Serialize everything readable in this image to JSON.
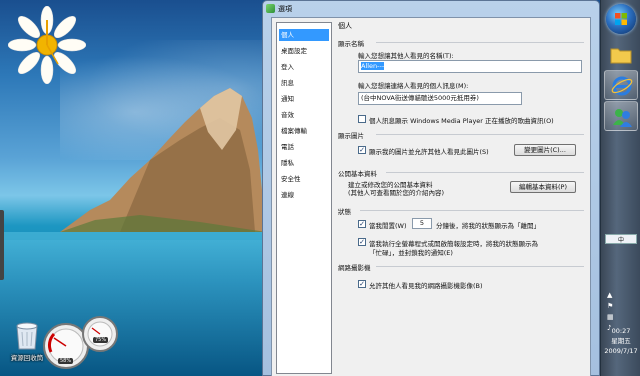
{
  "desktop": {
    "recycle_bin_label": "資源回收筒",
    "gauge_cpu": "58%",
    "gauge_mem": "75%"
  },
  "window": {
    "title": "選項",
    "nav_items": [
      "個人",
      "桌面設定",
      "登入",
      "訊息",
      "通知",
      "音效",
      "檔案傳輸",
      "電話",
      "隱私",
      "安全性",
      "連線"
    ],
    "pane_title": "個人",
    "display_name": {
      "section": "顯示名稱",
      "name_label": "輸入您想讓其他人看見的名稱(T):",
      "name_value": "Allen---",
      "message_label": "輸入您想讓連絡人看見的個人訊息(M):",
      "message_value": "(台中NOVA街送傳貓聽送5000元抵用券)",
      "media_checkbox": "個人訊息顯示 Windows Media Player 正在播放的歌曲資訊(O)",
      "media_checked": false
    },
    "display_picture": {
      "section": "顯示圖片",
      "show_checkbox": "顯示我的圖片並允許其他人看見此圖片(S)",
      "show_checked": true,
      "change_button": "變更圖片(C)..."
    },
    "public_profile": {
      "section": "公開基本資料",
      "desc_line1": "建立或修改您的公開基本資料",
      "desc_line2": "(其他人可查看關於您的介紹內容)",
      "edit_button": "編輯基本資料(P)"
    },
    "status": {
      "section": "狀態",
      "away_prefix": "當我閒置(W)",
      "away_minutes": "5",
      "away_suffix": "分鐘後，將我的狀態顯示為「離開」",
      "away_checked": true,
      "busy_line1": "當我執行全螢幕程式或開啟簡報設定時，將我的狀態顯示為",
      "busy_line2": "「忙碌」，並封鎖我的通知(E)",
      "busy_checked": true
    },
    "webcam": {
      "section": "網路攝影機",
      "allow_checkbox": "允許其他人看見我的網路攝影機影像(B)",
      "allow_checked": true
    }
  },
  "taskbar": {
    "ime_label": "中",
    "clock_time": "00:27",
    "clock_day": "星期五",
    "clock_date": "2009/7/17"
  },
  "colors": {
    "selection": "#3399ff",
    "window_frame": "#b9d1ea",
    "taskbar": "#55677c"
  }
}
